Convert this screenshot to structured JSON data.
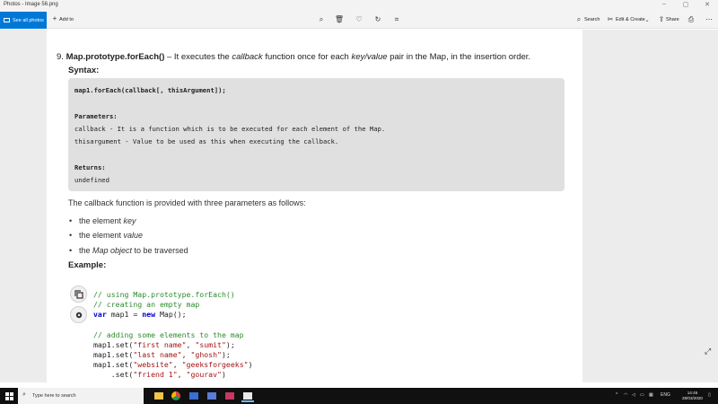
{
  "window": {
    "title": "Photos - Image 56.png"
  },
  "toolbar": {
    "see_all_photos": "See all photos",
    "add_to": "Add to",
    "search": "Search",
    "edit_create": "Edit & Create",
    "share": "Share"
  },
  "doc": {
    "heading_num": "9.",
    "heading_method": "Map.prototype.forEach()",
    "heading_dash": " – It executes the ",
    "heading_callback": "callback",
    "heading_mid": " function once for each ",
    "heading_kv": "key/value",
    "heading_end": " pair in the Map, in the insertion order.",
    "syntax_label": "Syntax:",
    "syntax_lines": [
      "map1.forEach(callback[, thisArgument]);",
      "Parameters:",
      "callback - It is a function which is to be executed for each element of the Map.",
      "thisargument - Value to be used as this when executing the callback.",
      "Returns:",
      "undefined"
    ],
    "paragraph": "The callback function is provided with three parameters as follows:",
    "bullets": [
      {
        "pre": "the element ",
        "em": "key",
        "post": ""
      },
      {
        "pre": "the element ",
        "em": "value",
        "post": ""
      },
      {
        "pre": "the ",
        "em": "Map object",
        "post": " to be traversed"
      }
    ],
    "example_label": "Example:",
    "example_code": {
      "c1": "// using Map.prototype.forEach()",
      "c2": "// creating an empty map",
      "l3_kw1": "var",
      "l3_mid": " map1 = ",
      "l3_kw2": "new",
      "l3_end": " Map();",
      "c4": "// adding some elements to the map",
      "s1_pre": "map1.set(",
      "s1_a": "\"first name\"",
      "s1_b": "\"sumit\"",
      "s2_pre": "map1.set(",
      "s2_a": "\"last name\"",
      "s2_b": "\"ghosh\"",
      "s3_pre": "map1.set(",
      "s3_a": "\"website\"",
      "s3_b": "\"geeksforgeeks\"",
      "s4_pre": "    .set(",
      "s4_a": "\"friend 1\"",
      "s4_b": "\"gourav\""
    }
  },
  "taskbar": {
    "search_placeholder": "Type here to search",
    "lang": "ENG",
    "time": "14:45",
    "date": "28/03/2020"
  }
}
